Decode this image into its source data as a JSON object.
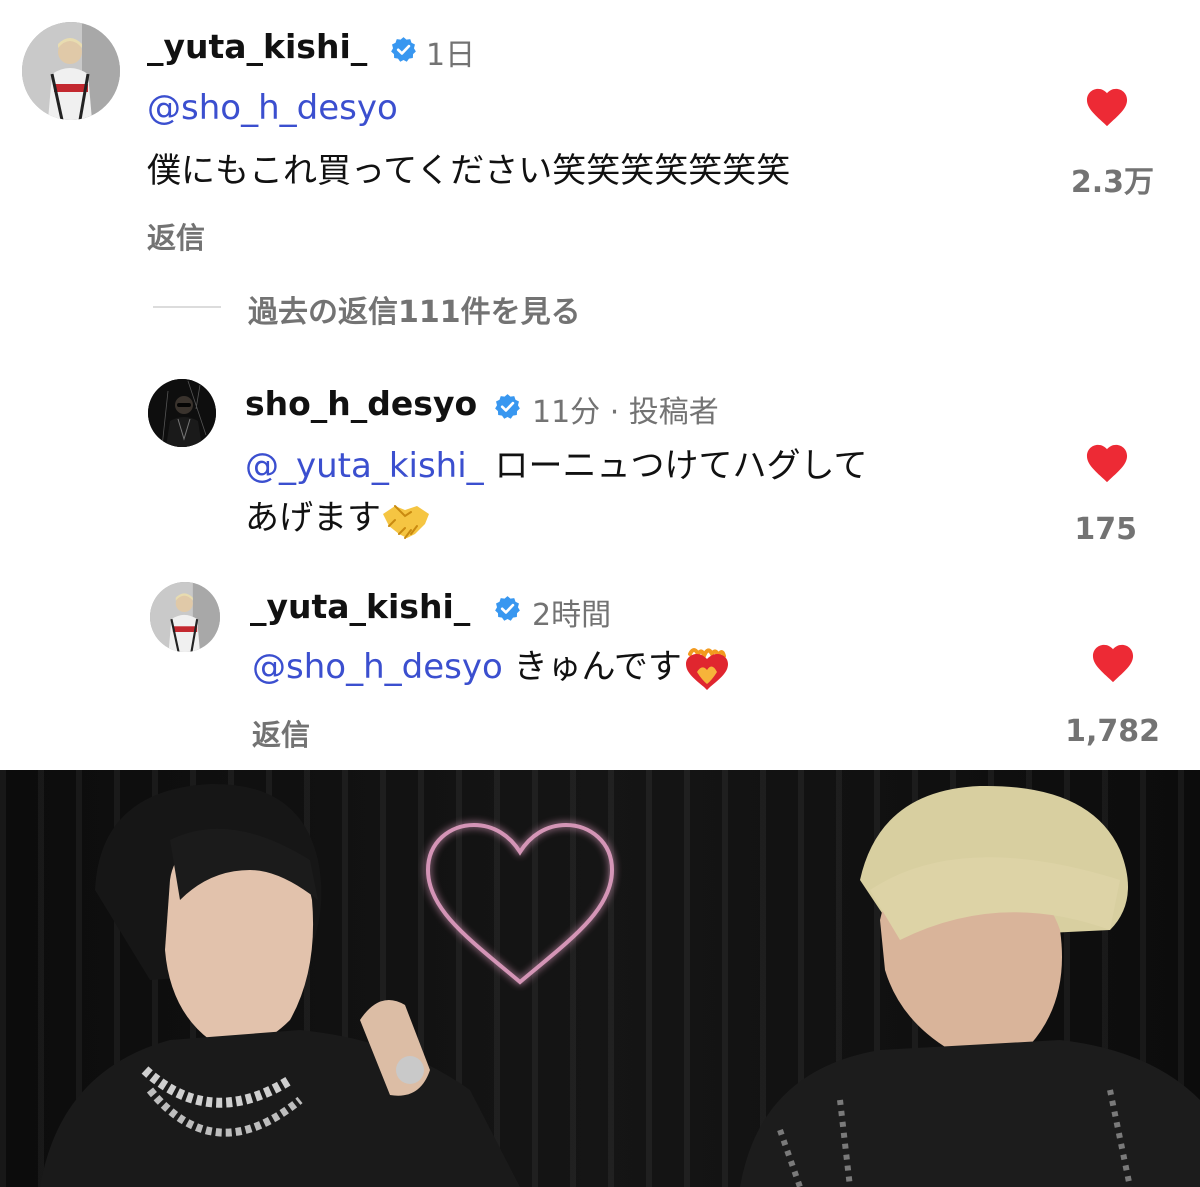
{
  "comments": [
    {
      "username": "_yuta_kishi_",
      "time": "1日",
      "mention": "@sho_h_desyo",
      "text": "僕にもこれ買ってください笑笑笑笑笑笑笑",
      "reply_label": "返信",
      "likes": "2.3万"
    }
  ],
  "view_replies": "過去の返信111件を見る",
  "replies": [
    {
      "username": "sho_h_desyo",
      "time": "11分 · 投稿者",
      "mention": "@_yuta_kishi_",
      "text_line1": "ローニュつけてハグして",
      "text_line2": "あげます",
      "emoji": "handshake-emoji",
      "likes": "175"
    },
    {
      "username": "_yuta_kishi_",
      "time": "2時間",
      "mention": "@sho_h_desyo",
      "text": "きゅんです",
      "emoji": "heart-on-fire-emoji",
      "reply_label": "返信",
      "likes": "1,782"
    }
  ],
  "colors": {
    "mention": "#3b4fcf",
    "heart": "#ed2a35",
    "verified": "#3897f0",
    "meta": "#737373"
  },
  "icons": [
    "verified-badge-icon",
    "heart-icon",
    "neon-heart"
  ]
}
